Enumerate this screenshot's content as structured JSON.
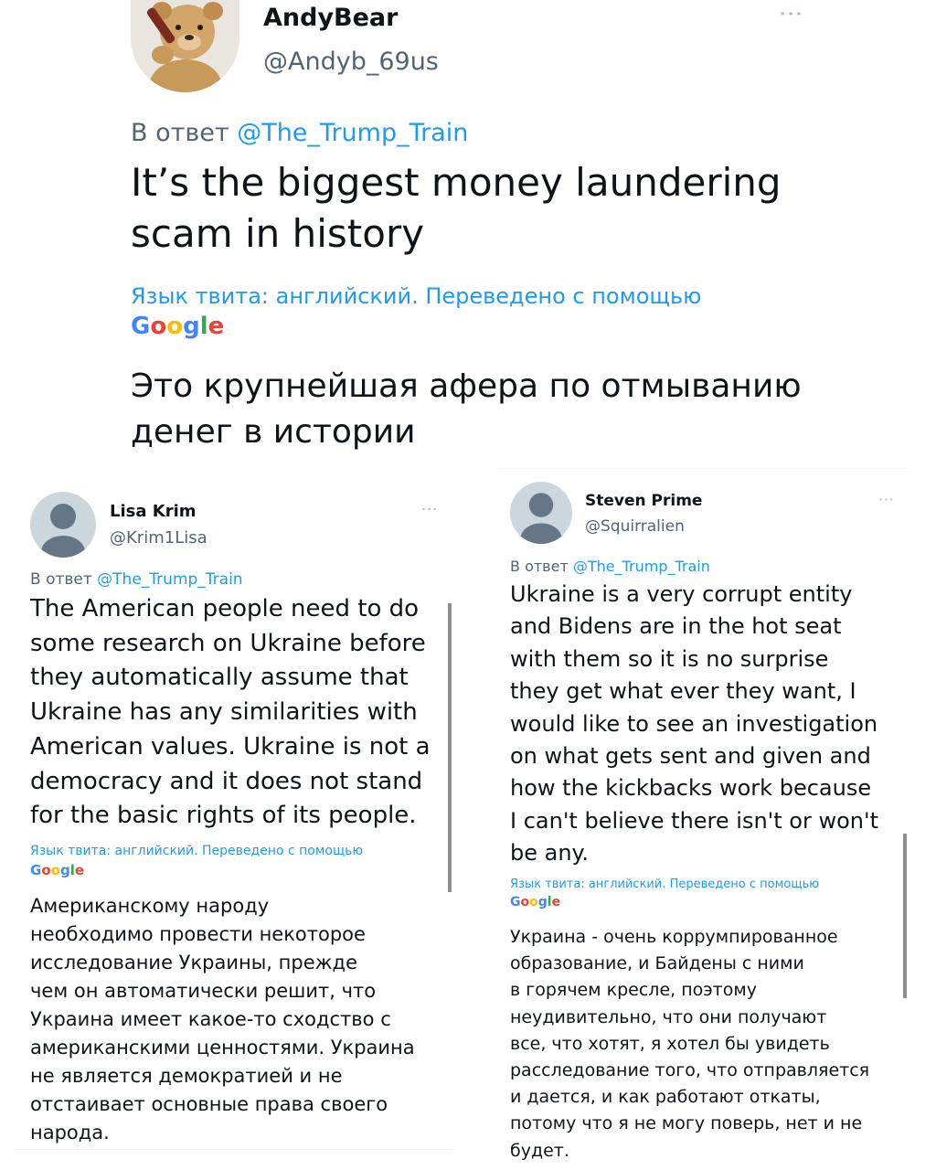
{
  "tweet_main": {
    "name": "AndyBear",
    "handle": "@Andyb_69us",
    "reply_prefix": "В ответ",
    "reply_to": "@The_Trump_Train",
    "text_line1": "It’s the biggest money laundering",
    "text_line2": "scam in history",
    "translation_note": "Язык твита: английский. Переведено с помощью",
    "translation_line1": "Это крупнейшая афера по отмыванию",
    "translation_line2": "денег в истории",
    "google_label": "Google"
  },
  "tweet_left": {
    "name": "Lisa Krim",
    "handle": "@Krim1Lisa",
    "reply_prefix": "В ответ",
    "reply_to": "@The_Trump_Train",
    "text_lines": [
      "The American people need to do",
      "some research on Ukraine before",
      "they automatically assume that",
      "Ukraine has any similarities with",
      "American values. Ukraine is not a",
      "democracy and it does not stand",
      "for the basic rights of its people."
    ],
    "translation_note": "Язык твита: английский. Переведено с помощью",
    "google_label": "Google",
    "translation_lines": [
      "Американскому народу",
      "необходимо провести некоторое",
      "исследование Украины, прежде",
      "чем он автоматически решит, что",
      "Украина имеет какое-то сходство с",
      "американскими ценностями. Украина",
      "не является демократией и не",
      "отстаивает основные права своего",
      "народа."
    ]
  },
  "tweet_right": {
    "name": "Steven Prime",
    "handle": "@Squirralien",
    "reply_prefix": "В ответ",
    "reply_to": "@The_Trump_Train",
    "text_lines": [
      "Ukraine is a very corrupt entity",
      "and Bidens are in the hot seat",
      "with them so it is no surprise",
      "they get what ever they want, I",
      "would like to see an investigation",
      "on what gets sent and given and",
      "how the kickbacks work because",
      "I can't believe there isn't or won't",
      "be any."
    ],
    "translation_note": "Язык твита: английский. Переведено с помощью",
    "google_label": "Google",
    "translation_lines": [
      "Украина - очень коррумпированное",
      "образование, и Байдены с ними",
      "в горячем кресле, поэтому",
      "неудивительно, что они получают",
      "все, что хотят, я хотел бы увидеть",
      "расследование того, что отправляется",
      "и дается, и как работают откаты,",
      "потому что я не могу поверь, нет и не",
      "будет."
    ]
  },
  "colors": {
    "link": "#1d9bf0",
    "muted": "#536471",
    "avatar_default": "#ccd6dd"
  },
  "icons": [
    "teddy-bear-avatar",
    "default-avatar-icon",
    "more-options-icon",
    "google-logo"
  ]
}
